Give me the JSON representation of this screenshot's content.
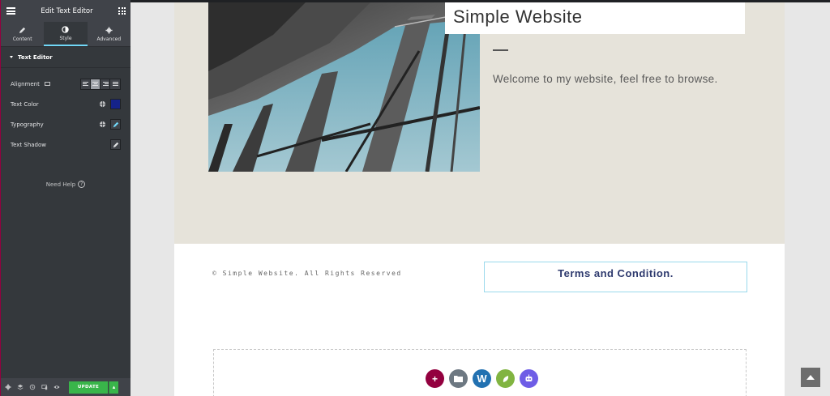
{
  "panel": {
    "title": "Edit Text Editor",
    "tabs": [
      {
        "label": "Content",
        "icon": "pencil-icon"
      },
      {
        "label": "Style",
        "icon": "half-circle-icon",
        "active": true
      },
      {
        "label": "Advanced",
        "icon": "gear-icon"
      }
    ],
    "section_title": "Text Editor",
    "controls": {
      "alignment_label": "Alignment",
      "alignment_selected": "center",
      "text_color_label": "Text Color",
      "text_color_value": "#15238a",
      "typography_label": "Typography",
      "text_shadow_label": "Text Shadow"
    },
    "need_help": "Need Help",
    "footer": {
      "update_label": "UPDATE",
      "icons": [
        "settings-icon",
        "layers-icon",
        "history-icon",
        "responsive-icon",
        "preview-eye-icon"
      ]
    }
  },
  "site": {
    "title": "Simple Website",
    "welcome": "Welcome to my website, feel free to browse.",
    "copyright": "© Simple Website. All Rights Reserved",
    "terms": "Terms and Condition."
  },
  "colors": {
    "panel_bg": "#34383c",
    "accent_cyan": "#71d7f7",
    "update_green": "#39b54a",
    "hero_bg": "#e6e3da",
    "terms_text": "#2e3a6e"
  },
  "dropzone": {
    "buttons": [
      {
        "name": "add-section-button",
        "glyph": "+",
        "color": "#93003f"
      },
      {
        "name": "add-template-button",
        "glyph": "folder",
        "color": "#6d7882"
      },
      {
        "name": "wordpress-button",
        "glyph": "W",
        "color": "#2271b1"
      },
      {
        "name": "envato-button",
        "glyph": "leaf",
        "color": "#81b441"
      },
      {
        "name": "ai-robot-button",
        "glyph": "robot",
        "color": "#6e5de6"
      }
    ]
  }
}
